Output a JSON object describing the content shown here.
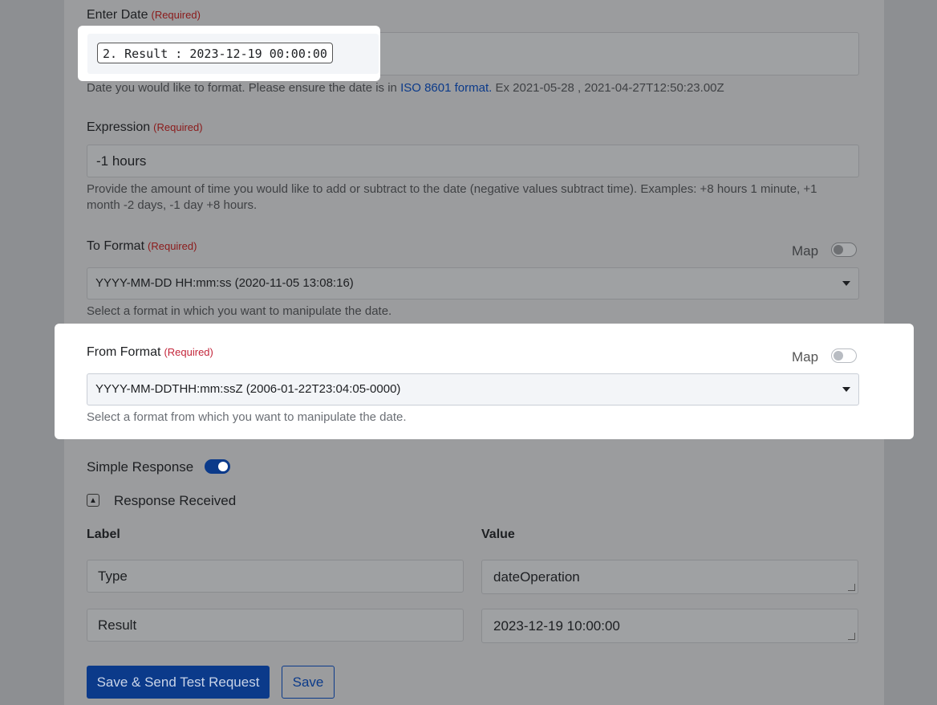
{
  "required_text": "(Required)",
  "enter_date": {
    "label": "Enter Date",
    "token": "2. Result : 2023-12-19 00:00:00",
    "help_prefix": "Date you would like to format. Please ensure the date is in",
    "help_link": "ISO 8601 format.",
    "help_suffix": "Ex 2021-05-28 , 2021-04-27T12:50:23.00Z"
  },
  "expression": {
    "label": "Expression",
    "value": "-1 hours",
    "help": "Provide the amount of time you would like to add or subtract to the date (negative values subtract time). Examples: +8 hours 1 minute, +1 month -2 days, -1 day +8 hours."
  },
  "to_format": {
    "label": "To Format",
    "map_label": "Map",
    "selected": "YYYY-MM-DD HH:mm:ss (2020-11-05 13:08:16)",
    "help": "Select a format in which you want to manipulate the date."
  },
  "from_format": {
    "label": "From Format",
    "map_label": "Map",
    "selected": "YYYY-MM-DDTHH:mm:ssZ (2006-01-22T23:04:05-0000)",
    "help": "Select a format from which you want to manipulate the date."
  },
  "simple_response": {
    "label": "Simple Response",
    "enabled": true
  },
  "response_received": {
    "label": "Response Received",
    "col_label": "Label",
    "col_value": "Value",
    "rows": [
      {
        "label": "Type",
        "value": "dateOperation"
      },
      {
        "label": "Result",
        "value": "2023-12-19 10:00:00"
      }
    ]
  },
  "buttons": {
    "save_send": "Save & Send Test Request",
    "save": "Save"
  },
  "colors": {
    "accent": "#0b63ce",
    "required": "#c3253a",
    "overlay": "#8d8f92"
  }
}
